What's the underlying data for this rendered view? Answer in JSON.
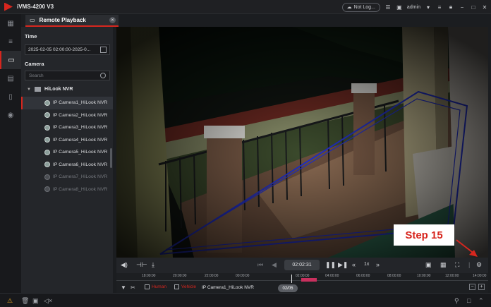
{
  "app": {
    "title": "iVMS-4200 V3",
    "status": "Not Log...",
    "user": "admin",
    "accent": "#d7261e"
  },
  "tab": {
    "label": "Remote Playback"
  },
  "panel": {
    "time_title": "Time",
    "time_value": "2025-02-05 02:00:00-2025-0...",
    "camera_title": "Camera",
    "search_placeholder": "Search",
    "nvr_label": "HiLook NVR",
    "cameras": [
      {
        "label": "IP Camera1_HiLook NVR",
        "state": "active"
      },
      {
        "label": "IP Camera2_HiLook NVR",
        "state": "online"
      },
      {
        "label": "IP Camera3_HiLook NVR",
        "state": "online"
      },
      {
        "label": "IP Camera4_HiLook NVR",
        "state": "online"
      },
      {
        "label": "IP Camera5_HiLook NVR",
        "state": "online"
      },
      {
        "label": "IP Camera6_HiLook NVR",
        "state": "online"
      },
      {
        "label": "IP Camera7_HiLook NVR",
        "state": "offline"
      },
      {
        "label": "IP Camera8_HiLook NVR",
        "state": "offline"
      }
    ]
  },
  "video": {
    "overlay_label": "Step 15"
  },
  "controls": {
    "current_time": "02:02:31",
    "speed": "1x"
  },
  "timeline": {
    "ticks": [
      "18:00:00",
      "20:00:00",
      "22:00:00",
      "00:00:00",
      "02:00:00",
      "04:00:00",
      "06:00:00",
      "08:00:00",
      "10:00:00",
      "12:00:00",
      "14:00:00"
    ]
  },
  "filter": {
    "human_label": "Human",
    "vehicle_label": "Vehicle",
    "camera_name": "IP Camera1_HiLook NVR",
    "date_badge": "02/05"
  }
}
